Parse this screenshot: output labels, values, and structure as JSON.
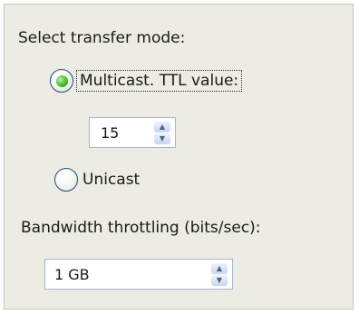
{
  "transfer_mode": {
    "title": "Select transfer mode:",
    "multicast": {
      "label": "Multicast. TTL value:",
      "selected": true
    },
    "ttl": {
      "value": "15"
    },
    "unicast": {
      "label": "Unicast",
      "selected": false
    }
  },
  "bandwidth": {
    "label": "Bandwidth throttling (bits/sec):",
    "value": "1 GB"
  },
  "icons": {
    "spin_up": "▲",
    "spin_down": "▼"
  }
}
